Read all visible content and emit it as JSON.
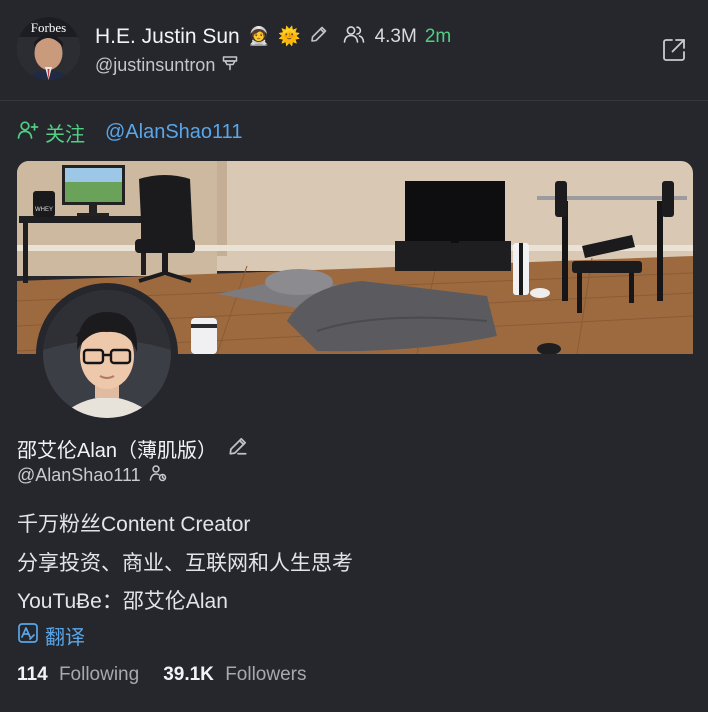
{
  "post_header": {
    "author_name": "H.E. Justin Sun",
    "author_badges": [
      "🧑‍🚀",
      "🌞"
    ],
    "follower_count": "4.3M",
    "time_ago": "2m",
    "handle": "@justinsuntron",
    "avatar_text": "Forbes"
  },
  "action": {
    "verb": "关注",
    "target": "@AlanShao111"
  },
  "profile": {
    "display_name": "邵艾伦Alan（薄肌版）",
    "handle": "@AlanShao111",
    "bio": [
      "千万粉丝Content Creator",
      "分享投资、商业、互联网和人生思考",
      "YouTuɃe：邵艾伦Alan"
    ],
    "translate_label": "翻译",
    "following_count": "114",
    "following_label": "Following",
    "followers_count": "39.1K",
    "followers_label": "Followers"
  },
  "banner": {
    "jar_label": "WHEY"
  },
  "colors": {
    "background": "#26272d",
    "accent_blue": "#59a6e8",
    "accent_green": "#4fcf82",
    "text_primary": "#f2f3f5",
    "text_secondary": "#a7a9b0"
  },
  "icons": [
    "edit-pencil-icon",
    "users-icon",
    "external-link-icon",
    "filter-icon",
    "user-plus-icon",
    "user-clock-icon",
    "translate-icon"
  ]
}
